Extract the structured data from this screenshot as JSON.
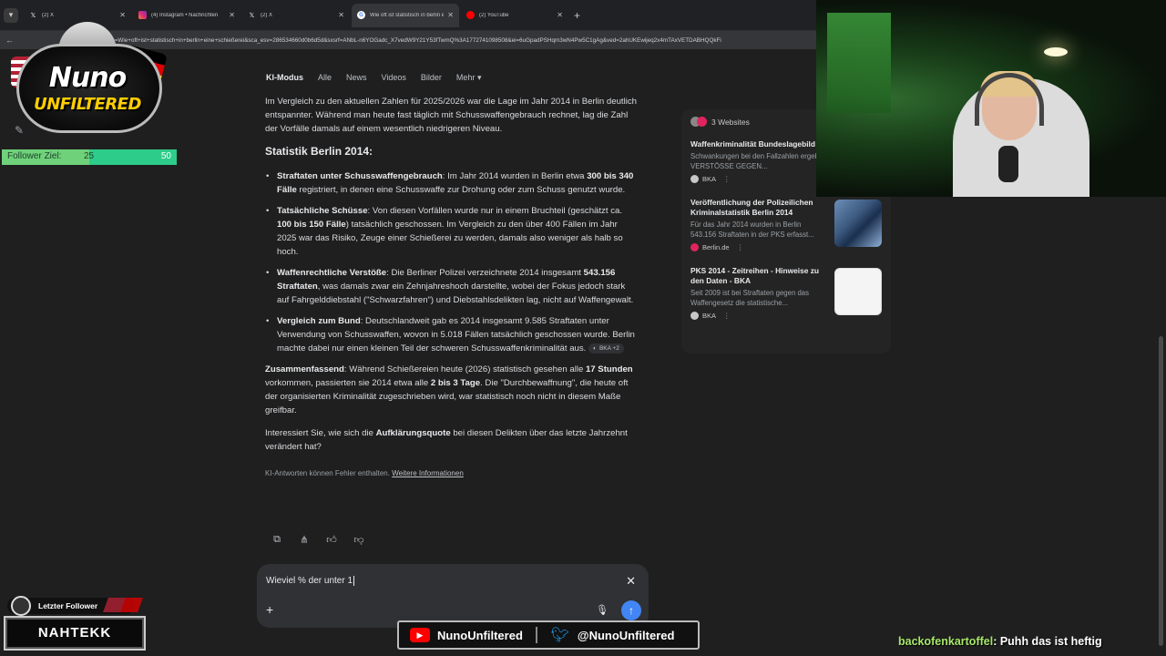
{
  "browser": {
    "tabs": [
      {
        "title": "(2) X",
        "icon": "x-icon",
        "active": false
      },
      {
        "title": "(4) Instagram • Nachrichten",
        "icon": "instagram-icon",
        "active": false
      },
      {
        "title": "(2) X",
        "icon": "x-icon",
        "active": false
      },
      {
        "title": "Wie oft ist statistisch in berlin e",
        "icon": "google-icon",
        "active": true
      },
      {
        "title": "(2) YouTube",
        "icon": "youtube-icon",
        "active": false
      }
    ],
    "url": "earch?q=Wie+oft+ist+statistisch+in+berlin+eine+schießerei&sca_esv=286534660d0b6d5d&sxsrf=ANbL-n6YOGadc_X7vedW9Y21Y53fTwmQ%3A1772741098508&ei=6uGpadPSHqm3wN4Pw5C1gAg&ved=2ahUKEwijeq2x4mTAxVETDABHQQkFi"
  },
  "search_tabs": [
    "KI-Modus",
    "Alle",
    "News",
    "Videos",
    "Bilder",
    "Mehr"
  ],
  "answer": {
    "intro": "Im Vergleich zu den aktuellen Zahlen für 2025/2026 war die Lage im Jahr 2014 in Berlin deutlich entspannter. Während man heute fast täglich mit Schusswaffengebrauch rechnet, lag die Zahl der Vorfälle damals auf einem wesentlich niedrigeren Niveau.",
    "heading": "Statistik Berlin 2014:",
    "bullets": [
      {
        "bold": "Straftaten unter Schusswaffengebrauch",
        "text1": ": Im Jahr 2014 wurden in Berlin etwa ",
        "bold2": "300 bis 340 Fälle",
        "text2": " registriert, in denen eine Schusswaffe zur Drohung oder zum Schuss genutzt wurde."
      },
      {
        "bold": "Tatsächliche Schüsse",
        "text1": ": Von diesen Vorfällen wurde nur in einem Bruchteil (geschätzt ca. ",
        "bold2": "100 bis 150 Fälle",
        "text2": ") tatsächlich geschossen. Im Vergleich zu den über 400 Fällen im Jahr 2025 war das Risiko, Zeuge einer Schießerei zu werden, damals also weniger als halb so hoch."
      },
      {
        "bold": "Waffenrechtliche Verstöße",
        "text1": ": Die Berliner Polizei verzeichnete 2014 insgesamt ",
        "bold2": "543.156 Straftaten",
        "text2": ", was damals zwar ein Zehnjahreshoch darstellte, wobei der Fokus jedoch stark auf Fahrgelddiebstahl (\"Schwarzfahren\") und Diebstahlsdelikten lag, nicht auf Waffengewalt."
      },
      {
        "bold": "Vergleich zum Bund",
        "text1": ": Deutschlandweit gab es 2014 insgesamt 9.585 Straftaten unter Verwendung von Schusswaffen, wovon in 5.018 Fällen tatsächlich geschossen wurde. Berlin machte dabei nur einen kleinen Teil der schweren Schusswaffenkriminalität aus.",
        "bold2": "",
        "text2": "",
        "chip": "BKA +2"
      }
    ],
    "summary_bold": "Zusammenfassend",
    "summary_text1": ": Während Schießereien heute (2026) statistisch gesehen alle ",
    "summary_bold2": "17 Stunden",
    "summary_text2": " vorkommen, passierten sie 2014 etwa alle ",
    "summary_bold3": "2 bis 3 Tage",
    "summary_text3": ". Die \"Durchbewaffnung\", die heute oft der organisierten Kriminalität zugeschrieben wird, war statistisch noch nicht in diesem Maße greifbar.",
    "question_text1": "Interessiert Sie, wie sich die ",
    "question_bold": "Aufklärungsquote",
    "question_text2": " bei diesen Delikten über das letzte Jahrzehnt verändert hat?",
    "disclaimer": "KI-Antworten können Fehler enthalten.",
    "disclaimer_link": "Weitere Informationen"
  },
  "sources": {
    "header": "3 Websites",
    "items": [
      {
        "title": "Waffenkriminalität Bundeslagebild 2014 - BKA",
        "snippet": "Schwankungen bei den Fallzahlen ergeben. * 2.1 VERSTÖSSE GEGEN...",
        "site": "BKA",
        "thumb": ""
      },
      {
        "title": "Veröffentlichung der Polizeilichen Kriminalstatistik Berlin 2014",
        "snippet": "Für das Jahr 2014 wurden in Berlin 543.156 Straftaten in der PKS erfasst...",
        "site": "Berlin.de",
        "thumb": "t1"
      },
      {
        "title": "PKS 2014 - Zeitreihen - Hinweise zu den Daten - BKA",
        "snippet": "Seit 2009 ist bei Straftaten gegen das Waffengesetz die statistische...",
        "site": "BKA",
        "thumb": "t2"
      }
    ]
  },
  "prompt": {
    "value": "Wieviel % der unter 1"
  },
  "overlay": {
    "logo_line1": "Nuno",
    "logo_line2": "UNFILTERED",
    "follower_label": "Follower Ziel:",
    "follower_current": "25",
    "follower_goal": "50",
    "follower_progress": 0.5,
    "last_follower_label": "Letzter Follower",
    "last_follower_name": "NAHTEKK",
    "youtube_handle": "NunoUnfiltered",
    "twitter_handle": "@NunoUnfiltered",
    "chat_user": "backofenkartoffel",
    "chat_message": ": Puhh das ist heftig"
  },
  "colors": {
    "accent_blue": "#4285f4",
    "follower_green": "#2ecc8a",
    "chat_user": "#a8e86a"
  }
}
